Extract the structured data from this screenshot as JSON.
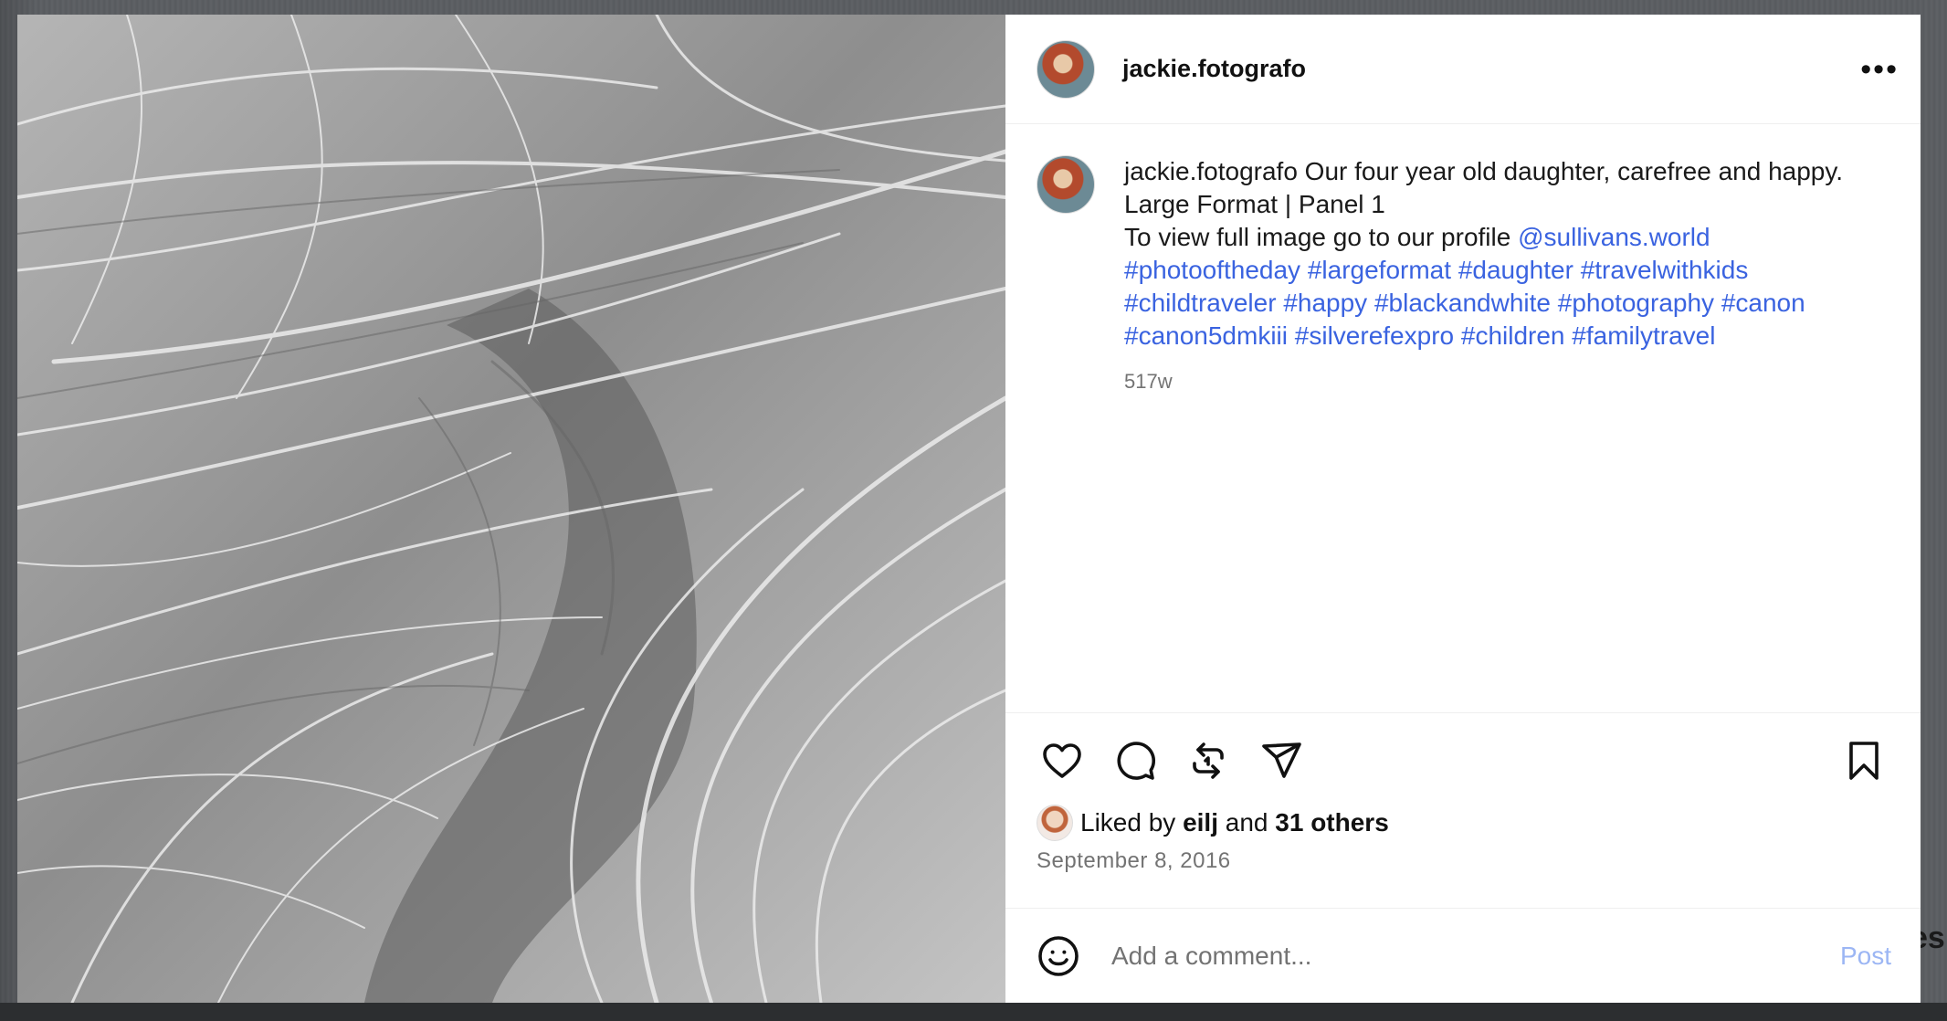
{
  "post": {
    "username": "jackie.fotografo",
    "more_glyph": "•••",
    "caption": {
      "username": "jackie.fotografo",
      "line1": " Our four year old daughter, carefree and happy.",
      "line2": "Large Format | Panel 1",
      "line3_prefix": "To view full image go to our profile ",
      "mention": "@sullivans.world",
      "hashtags": [
        "#photooftheday",
        "#largeformat",
        "#daughter",
        "#travelwithkids",
        "#childtraveler",
        "#happy",
        "#blackandwhite",
        "#photography",
        "#canon",
        "#canon5dmkiii",
        "#silverefexpro",
        "#children",
        "#familytravel"
      ],
      "time_ago": "517w"
    },
    "likes": {
      "prefix": "Liked by ",
      "first_liker": "eilj",
      "middle": " and ",
      "others": "31 others"
    },
    "date": "September 8, 2016",
    "comment": {
      "placeholder": "Add a comment...",
      "post_label": "Post"
    },
    "icons": {
      "like": "heart-icon",
      "comment": "comment-icon",
      "repost": "repost-icon",
      "share": "share-icon",
      "save": "bookmark-icon",
      "emoji": "smiley-icon"
    },
    "colors": {
      "link": "#3a63e0",
      "post_disabled": "#9cb6f4",
      "muted": "#737373"
    }
  },
  "backdrop": {
    "partial_text": "es"
  }
}
